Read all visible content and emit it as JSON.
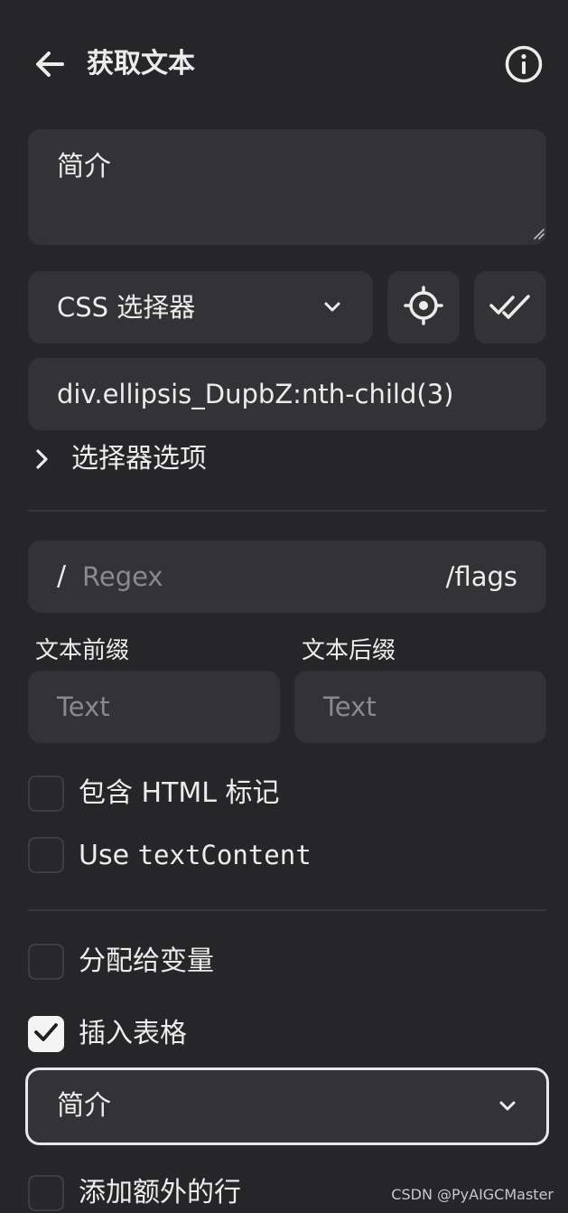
{
  "header": {
    "title": "获取文本",
    "back_icon": "arrow-left-icon",
    "info_icon": "info-circle-icon"
  },
  "description": {
    "value": "简介"
  },
  "selector": {
    "type_value": "CSS 选择器",
    "pick_icon": "crosshair-icon",
    "verify_icon": "double-check-icon",
    "value": "div.ellipsis_DupbZ:nth-child(3)",
    "options_label": "选择器选项"
  },
  "regex": {
    "prefix": "/",
    "placeholder": "Regex",
    "flags": "/flags"
  },
  "prefix_field": {
    "label": "文本前缀",
    "placeholder": "Text"
  },
  "suffix_field": {
    "label": "文本后缀",
    "placeholder": "Text"
  },
  "options": {
    "include_html": {
      "label": "包含 HTML 标记",
      "checked": false
    },
    "use_text_content": {
      "label_prefix": "Use ",
      "label_code": "textContent",
      "checked": false
    },
    "assign_variable": {
      "label": "分配给变量",
      "checked": false
    },
    "insert_table": {
      "label": "插入表格",
      "checked": true
    },
    "add_extra_row": {
      "label": "添加额外的行",
      "checked": false
    }
  },
  "table_column": {
    "value": "简介"
  },
  "watermark": "CSDN @PyAIGCMaster",
  "colors": {
    "background": "#262628",
    "surface": "#333336",
    "text": "#ececed",
    "placeholder": "#8a8a8e"
  }
}
